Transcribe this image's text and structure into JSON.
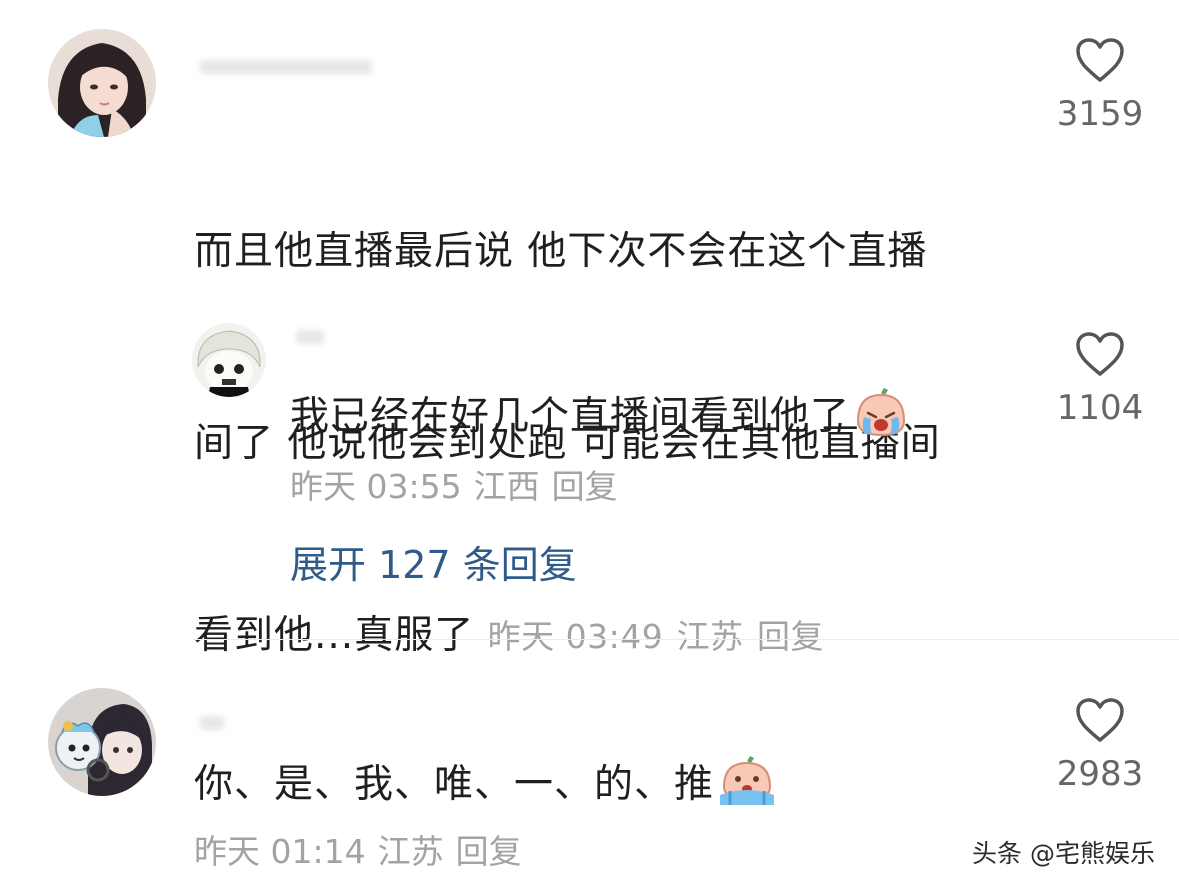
{
  "comments": [
    {
      "text_lines": [
        "而且他直播最后说 他下次不会在这个直播",
        "间了 他说他会到处跑 可能会在其他直播间",
        "看到他...真服了"
      ],
      "time": "昨天 03:49",
      "location": "江苏",
      "reply_label": "回复",
      "likes": "3159",
      "avatar_icon": "avatar-girl-icon"
    },
    {
      "text": "我已经在好几个直播间看到他了",
      "emoji": "crying-face-emoji",
      "time": "昨天 03:55",
      "location": "江西",
      "reply_label": "回复",
      "likes": "1104",
      "avatar_icon": "avatar-cartoon-icon"
    },
    {
      "text": "你、是、我、唯、一、的、推",
      "emoji": "sobbing-face-emoji",
      "time": "昨天 01:14",
      "location": "江苏",
      "reply_label": "回复",
      "likes": "2983",
      "avatar_icon": "avatar-anime-icon"
    }
  ],
  "expand_replies": "展开 127 条回复",
  "watermark": "头条 @宅熊娱乐",
  "colors": {
    "text": "#1f1f1f",
    "meta": "#a3a3a3",
    "link": "#2e5b8a",
    "heart": "#555555"
  }
}
